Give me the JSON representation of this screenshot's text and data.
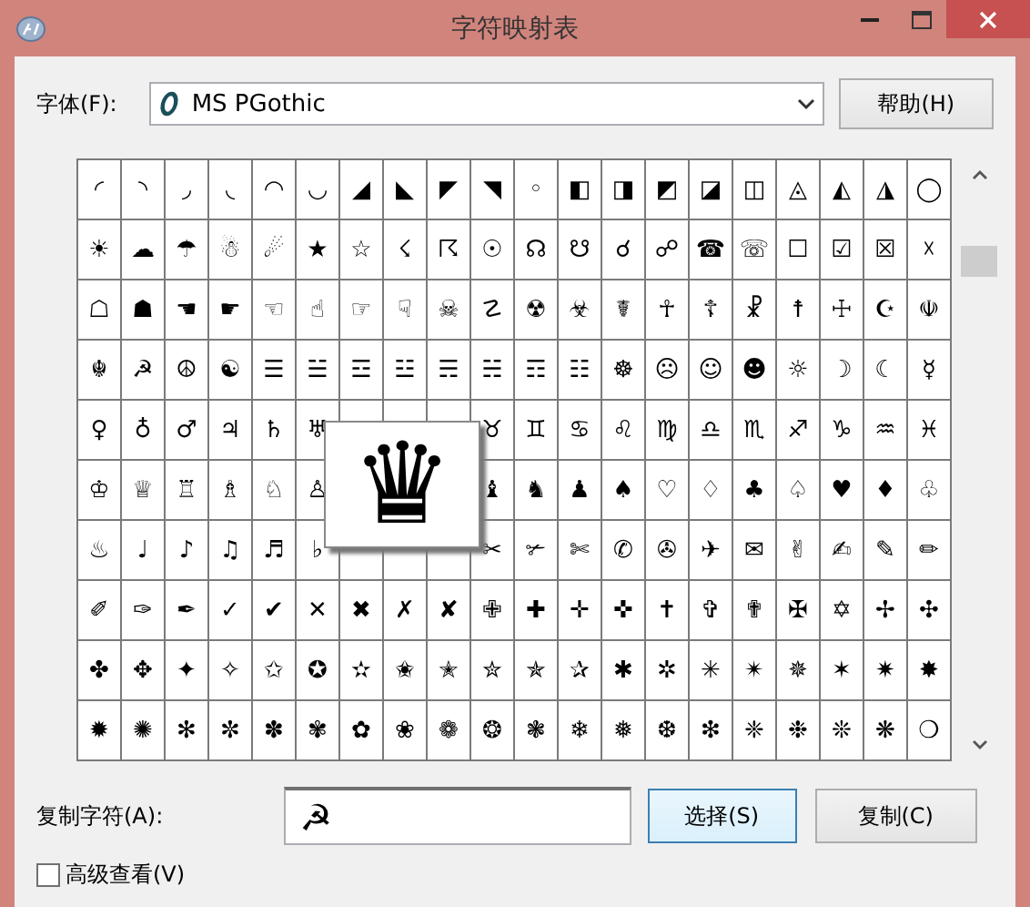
{
  "window": {
    "title": "字符映射表"
  },
  "font": {
    "label": "字体(F):",
    "value": "MS PGothic"
  },
  "help_button": "帮助(H)",
  "grid": {
    "rows": [
      [
        "◜",
        "◝",
        "◞",
        "◟",
        "◠",
        "◡",
        "◢",
        "◣",
        "◤",
        "◥",
        "◦",
        "◧",
        "◨",
        "◩",
        "◪",
        "◫",
        "◬",
        "◭",
        "◮",
        "◯"
      ],
      [
        "☀",
        "☁",
        "☂",
        "☃",
        "☄",
        "★",
        "☆",
        "☇",
        "☈",
        "☉",
        "☊",
        "☋",
        "☌",
        "☍",
        "☎",
        "☏",
        "☐",
        "☑",
        "☒",
        "☓"
      ],
      [
        "☖",
        "☗",
        "☚",
        "☛",
        "☜",
        "☝",
        "☞",
        "☟",
        "☠",
        "☡",
        "☢",
        "☣",
        "☤",
        "☥",
        "☦",
        "☧",
        "☨",
        "☩",
        "☪",
        "☫"
      ],
      [
        "☬",
        "☭",
        "☮",
        "☯",
        "☰",
        "☱",
        "☲",
        "☳",
        "☴",
        "☵",
        "☶",
        "☷",
        "☸",
        "☹",
        "☺",
        "☻",
        "☼",
        "☽",
        "☾",
        "☿"
      ],
      [
        "♀",
        "♁",
        "♂",
        "♃",
        "♄",
        "♅",
        null,
        null,
        null,
        "♉",
        "♊",
        "♋",
        "♌",
        "♍",
        "♎",
        "♏",
        "♐",
        "♑",
        "♒",
        "♓"
      ],
      [
        "♔",
        "♕",
        "♖",
        "♗",
        "♘",
        "♙",
        null,
        null,
        null,
        "♝",
        "♞",
        "♟",
        "♠",
        "♡",
        "♢",
        "♣",
        "♤",
        "♥",
        "♦",
        "♧"
      ],
      [
        "♨",
        "♩",
        "♪",
        "♫",
        "♬",
        "♭",
        null,
        null,
        null,
        "✂",
        "✃",
        "✄",
        "✆",
        "✇",
        "✈",
        "✉",
        "✌",
        "✍",
        "✎",
        "✏"
      ],
      [
        "✐",
        "✑",
        "✒",
        "✓",
        "✔",
        "✕",
        "✖",
        "✗",
        "✘",
        "✙",
        "✚",
        "✛",
        "✜",
        "✝",
        "✞",
        "✟",
        "✠",
        "✡",
        "✢",
        "✣"
      ],
      [
        "✤",
        "✥",
        "✦",
        "✧",
        "✩",
        "✪",
        "✫",
        "✬",
        "✭",
        "✮",
        "✯",
        "✰",
        "✱",
        "✲",
        "✳",
        "✴",
        "✵",
        "✶",
        "✷",
        "✸"
      ],
      [
        "✹",
        "✺",
        "✻",
        "✼",
        "✽",
        "✾",
        "✿",
        "❀",
        "❁",
        "❂",
        "❃",
        "❄",
        "❅",
        "❆",
        "❇",
        "❈",
        "❉",
        "❊",
        "❋",
        "❍"
      ]
    ]
  },
  "magnified": {
    "glyph": "♛"
  },
  "copy": {
    "label": "复制字符(A):",
    "value": "☭"
  },
  "buttons": [
    {
      "label": "选择(S)",
      "focused": true
    },
    {
      "label": "复制(C)",
      "focused": false
    }
  ],
  "advanced_view": {
    "label": "高级查看(V)",
    "checked": false
  }
}
